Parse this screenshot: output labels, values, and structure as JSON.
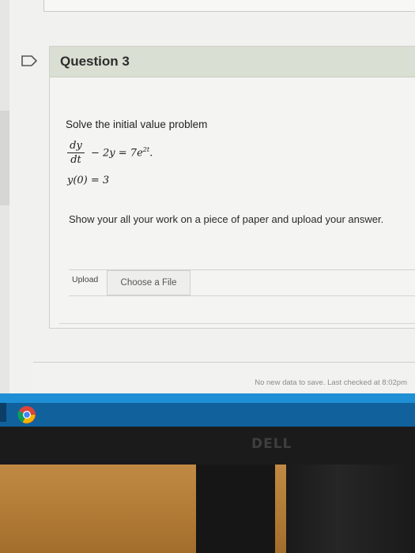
{
  "question": {
    "title": "Question 3",
    "prompt": "Solve the initial value problem",
    "equation": {
      "numerator": "dy",
      "denominator": "dt",
      "rest": "− 2y = 7e",
      "exponent": "2t",
      "period": ".",
      "initial_condition": "y(0) = 3"
    },
    "instructions": "Show your all your work on a piece of paper and upload your answer.",
    "upload": {
      "label": "Upload",
      "choose_file_label": "Choose a File"
    }
  },
  "save_status": "No new data to save. Last checked at 8:02pm",
  "monitor": {
    "brand": "DELL"
  },
  "colors": {
    "header_bg": "#d9dfd2",
    "taskbar": "#1e8fd4",
    "desk": "#c08a44"
  },
  "icons": {
    "flag": "flag-outline-icon",
    "taskbar_app": "chrome-icon"
  }
}
